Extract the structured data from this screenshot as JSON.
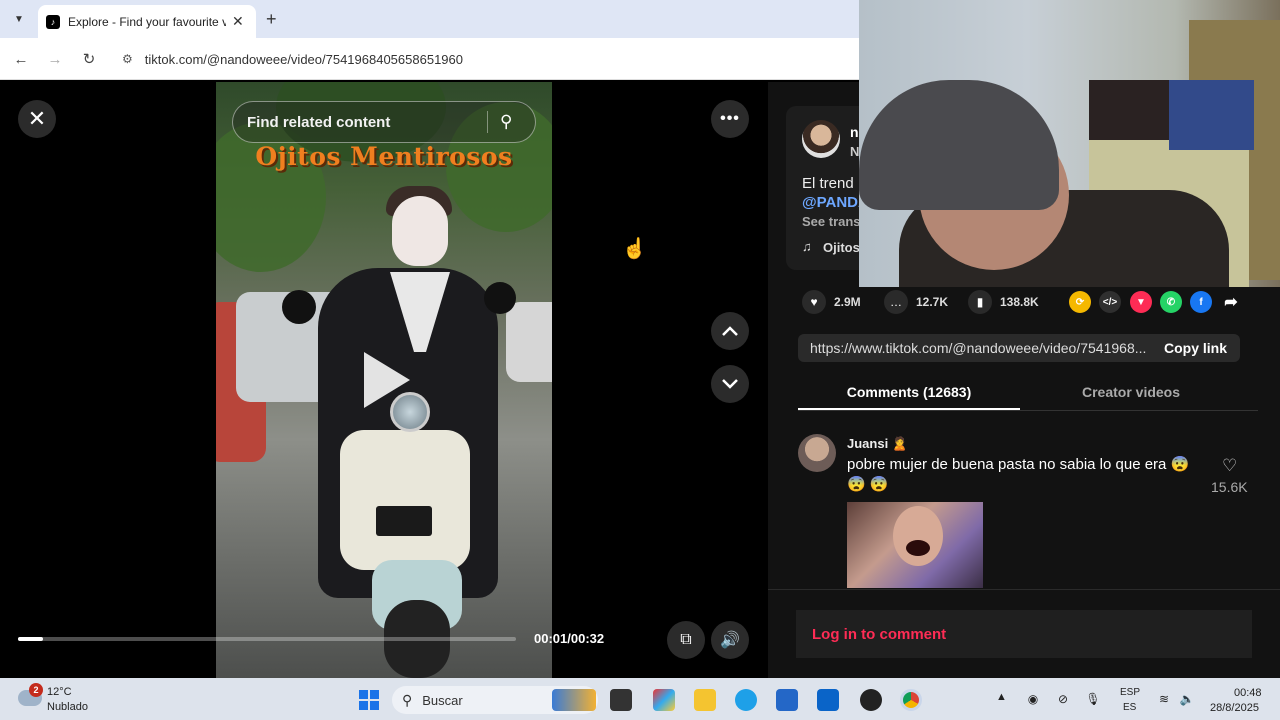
{
  "browser": {
    "tab_title": "Explore - Find your favourite vi",
    "url": "tiktok.com/@nandoweee/video/7541968405658651960"
  },
  "video": {
    "search_placeholder": "Find related content",
    "title_overlay": "Ojitos Mentirosos",
    "time": "00:01/00:32",
    "progress": 0.05
  },
  "description": {
    "author_name": "n",
    "author_sub": "N",
    "text": "El trend",
    "mention": "@PANDA",
    "see_translation": "See trans",
    "music": "Ojitos"
  },
  "actions": {
    "likes": "2.9M",
    "comments": "12.7K",
    "saves": "138.8K"
  },
  "share": {
    "link": "https://www.tiktok.com/@nandoweee/video/7541968...",
    "copy_label": "Copy link"
  },
  "tabs": {
    "comments": "Comments (12683)",
    "creator": "Creator videos"
  },
  "comment": {
    "user": "Juansi 🙎",
    "text": "pobre mujer de buena pasta no sabia lo que era 😨 😨 😨",
    "likes": "15.6K"
  },
  "footer": {
    "login": "Log in to comment"
  },
  "taskbar": {
    "weather_badge": "2",
    "temperature": "12°C",
    "condition": "Nublado",
    "search": "Buscar",
    "lang_top": "ESP",
    "lang_bottom": "ES",
    "time": "00:48",
    "date": "28/8/2025"
  },
  "colors": {
    "accent_login": "#fe2c55",
    "title_orange": "#f07f1f",
    "mention_blue": "#6da7ff"
  }
}
